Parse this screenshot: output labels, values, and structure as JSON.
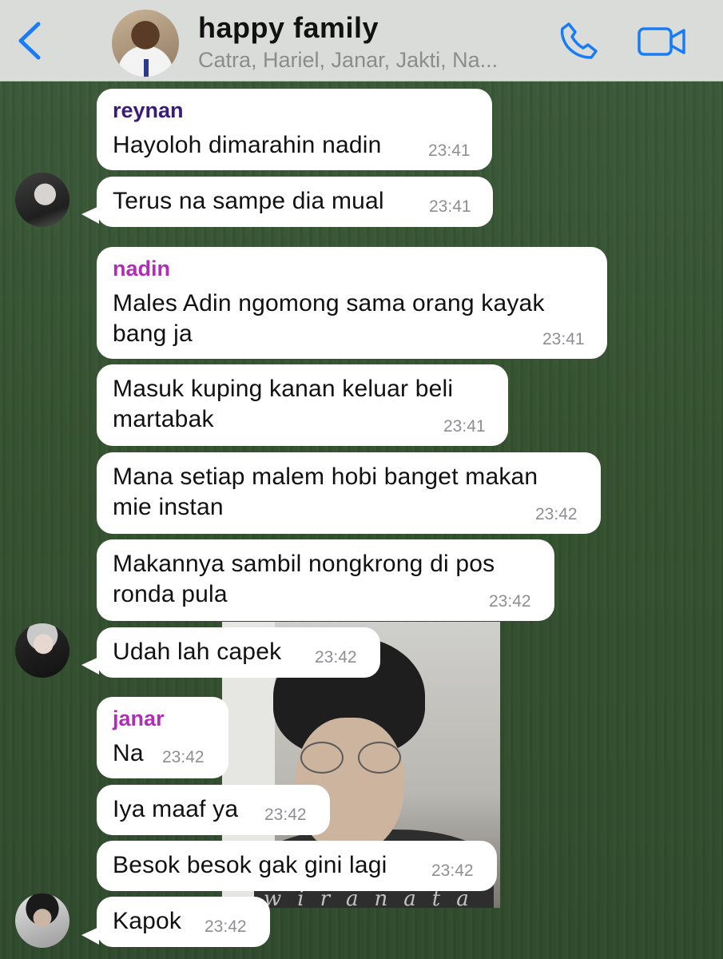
{
  "header": {
    "back_label": "",
    "title": "happy family",
    "members": "Catra, Hariel, Janar, Jakti, Na...",
    "icons": [
      "chevron-left-icon",
      "phone-icon",
      "video-camera-icon"
    ],
    "accent_color": "#1a7cf5"
  },
  "watermark": "wiranata",
  "sender_colors": {
    "reynan": "#3a1a7a",
    "nadin": "#b02db8",
    "janar": "#b02db8"
  },
  "messages": [
    {
      "sender": "reynan",
      "lines": [
        "Hayoloh dimarahin nadin"
      ],
      "time": "23:41"
    },
    {
      "sender": "",
      "lines": [
        "Terus na sampe dia mual"
      ],
      "time": "23:41"
    },
    {
      "sender": "nadin",
      "lines": [
        "Males Adin ngomong sama orang kayak",
        "bang ja"
      ],
      "time": "23:41"
    },
    {
      "sender": "",
      "lines": [
        "Masuk kuping kanan keluar beli",
        "martabak"
      ],
      "time": "23:41"
    },
    {
      "sender": "",
      "lines": [
        "Mana setiap malem hobi banget makan",
        "mie instan"
      ],
      "time": "23:42"
    },
    {
      "sender": "",
      "lines": [
        "Makannya sambil nongkrong di pos",
        "ronda pula"
      ],
      "time": "23:42"
    },
    {
      "sender": "",
      "lines": [
        "Udah lah capek"
      ],
      "time": "23:42"
    },
    {
      "sender": "janar",
      "lines": [
        "Na"
      ],
      "time": "23:42"
    },
    {
      "sender": "",
      "lines": [
        "Iya maaf ya"
      ],
      "time": "23:42"
    },
    {
      "sender": "",
      "lines": [
        "Besok besok gak gini lagi"
      ],
      "time": "23:42"
    },
    {
      "sender": "",
      "lines": [
        "Kapok"
      ],
      "time": "23:42"
    }
  ]
}
